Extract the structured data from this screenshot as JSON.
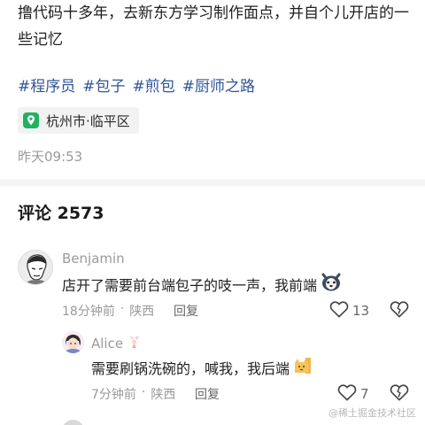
{
  "post": {
    "text": "撸代码十多年，去新东方学习制作面点，并自个儿开店的一些记忆",
    "tags": [
      "#程序员",
      "#包子",
      "#煎包",
      "#厨师之路"
    ],
    "location": "杭州市·临平区",
    "time": "昨天09:53"
  },
  "comments_header": "评论 2573",
  "comments": [
    {
      "author": "Benjamin",
      "text": "店开了需要前台端包子的吱一声，我前端",
      "emoji_icon": "husky-dog-emoji",
      "time": "18分钟前",
      "region": "陕西",
      "reply_label": "回复",
      "likes": "13"
    },
    {
      "author": "Alice",
      "author_badge_icon": "fairy-icon",
      "text": "需要刷锅洗碗的，喊我，我后端",
      "emoji_icon": "cat-emoji",
      "time": "7分钟前",
      "region": "陕西",
      "reply_label": "回复",
      "likes": "7"
    }
  ],
  "watermark": "@稀土掘金技术社区",
  "colors": {
    "tag": "#2f5596",
    "pin": "#20b262",
    "muted": "#9a9a9a"
  }
}
